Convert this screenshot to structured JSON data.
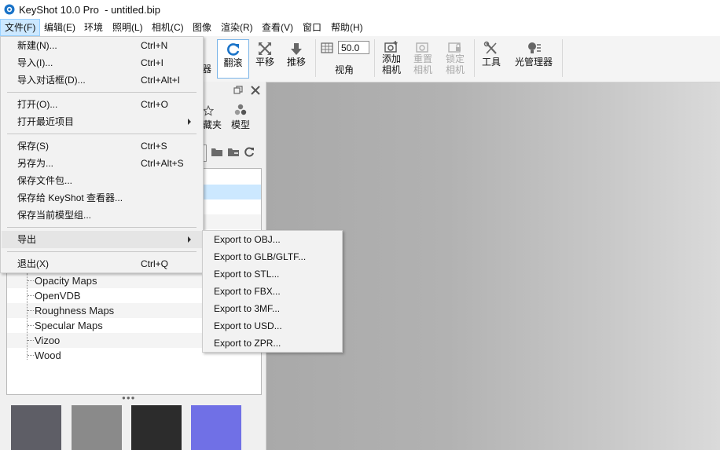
{
  "window": {
    "title": "KeyShot 10.0 Pro  - untitled.bip"
  },
  "colors": {
    "accent": "#1a73c8",
    "menu_active_bg": "#cce8ff",
    "viewport_left": "#a9a9a9",
    "viewport_right": "#dadada"
  },
  "menubar": {
    "items": [
      "文件(F)",
      "编辑(E)",
      "环境",
      "照明(L)",
      "相机(C)",
      "图像",
      "渲染(R)",
      "查看(V)",
      "窗口",
      "帮助(H)"
    ]
  },
  "toolbar": {
    "partial_label": "器",
    "tumble": "翻滚",
    "pan": "平移",
    "dolly": "推移",
    "fov_value": "50.0",
    "fov_label": "视角",
    "add_camera_1": "添加",
    "add_camera_2": "相机",
    "reset_camera_1": "重置",
    "reset_camera_2": "相机",
    "lock_camera_1": "锁定",
    "lock_camera_2": "相机",
    "tools": "工具",
    "light_manager": "光管理器"
  },
  "library": {
    "tab_favorites": "藏夹",
    "tab_models": "模型",
    "tree_items": [
      "Opacity Maps",
      "OpenVDB",
      "Roughness Maps",
      "Specular Maps",
      "Vizoo",
      "Wood"
    ],
    "more_indicator": "●●●",
    "swatch_colors": [
      "#5e5e66",
      "#8a8a8a",
      "#2c2c2c",
      "#7070e6"
    ]
  },
  "file_menu": {
    "new_label": "新建(N)...",
    "new_shortcut": "Ctrl+N",
    "import_label": "导入(I)...",
    "import_shortcut": "Ctrl+I",
    "import_dialog_label": "导入对话框(D)...",
    "import_dialog_shortcut": "Ctrl+Alt+I",
    "open_label": "打开(O)...",
    "open_shortcut": "Ctrl+O",
    "recent_label": "打开最近项目",
    "save_label": "保存(S)",
    "save_shortcut": "Ctrl+S",
    "save_as_label": "另存为...",
    "save_as_shortcut": "Ctrl+Alt+S",
    "save_package_label": "保存文件包...",
    "save_viewer_label": "保存给 KeyShot 查看器...",
    "save_model_set_label": "保存当前模型组...",
    "export_label": "导出",
    "exit_label": "退出(X)",
    "exit_shortcut": "Ctrl+Q"
  },
  "export_menu": {
    "items": [
      "Export to OBJ...",
      "Export to GLB/GLTF...",
      "Export to STL...",
      "Export to FBX...",
      "Export to 3MF...",
      "Export to USD...",
      "Export to ZPR..."
    ]
  }
}
